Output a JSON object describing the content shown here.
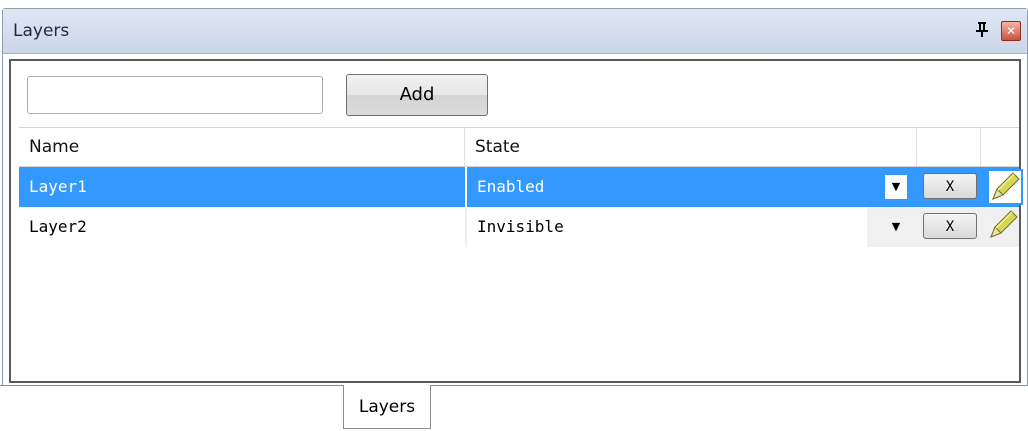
{
  "window": {
    "title": "Layers",
    "pin_glyph": "ⵙ",
    "close_glyph": "✕"
  },
  "toolbar": {
    "input_value": "",
    "add_label": "Add"
  },
  "grid": {
    "columns": [
      "Name",
      "State"
    ],
    "rows": [
      {
        "name": "Layer1",
        "state": "Enabled",
        "selected": true,
        "delete_label": "X"
      },
      {
        "name": "Layer2",
        "state": "Invisible",
        "selected": false,
        "delete_label": "X"
      }
    ]
  },
  "tabs": [
    {
      "label": "Layers"
    }
  ],
  "colors": {
    "selection": "#3399ff",
    "pencil_body": "#c9c94a",
    "pencil_tip": "#7a7a2a"
  }
}
